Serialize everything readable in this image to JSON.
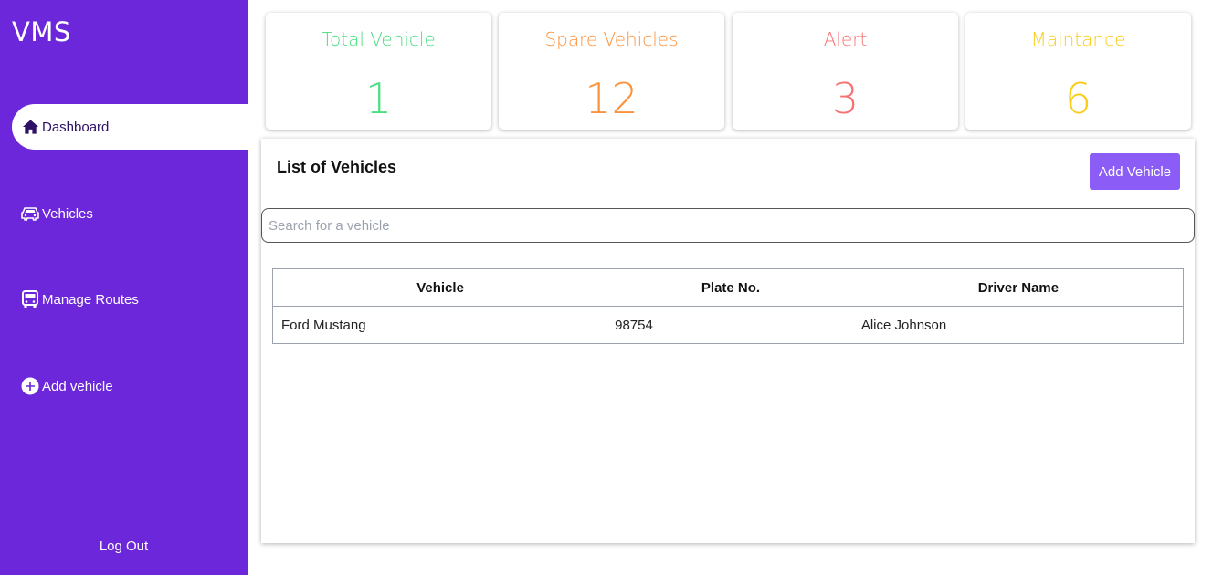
{
  "app": {
    "brand": "VMS"
  },
  "sidebar": {
    "items": [
      {
        "label": "Dashboard",
        "icon": "home-icon",
        "active": true
      },
      {
        "label": "Vehicles",
        "icon": "car-icon"
      },
      {
        "label": "Manage Routes",
        "icon": "bus-icon"
      },
      {
        "label": "Add vehicle",
        "icon": "plus-circle-icon"
      }
    ],
    "logout_label": "Log Out"
  },
  "stats": [
    {
      "title": "Total Vehicle",
      "value": "1",
      "color": "#4ade80"
    },
    {
      "title": "Spare Vehicles",
      "value": "12",
      "color": "#fb923c"
    },
    {
      "title": "Alert",
      "value": "3",
      "color": "#f87171"
    },
    {
      "title": "Maintance",
      "value": "6",
      "color": "#facc15"
    }
  ],
  "vehicles_panel": {
    "title": "List of Vehicles",
    "add_button_label": "Add Vehicle",
    "search_placeholder": "Search for a vehicle",
    "search_value": "",
    "columns": [
      "Vehicle",
      "Plate No.",
      "Driver Name"
    ],
    "rows": [
      {
        "vehicle": "Ford Mustang",
        "plate": "98754",
        "driver": "Alice Johnson"
      }
    ]
  },
  "colors": {
    "sidebar": "#6b27d9",
    "accent_button": "#8b5cf6",
    "active_text": "#2e1065"
  }
}
